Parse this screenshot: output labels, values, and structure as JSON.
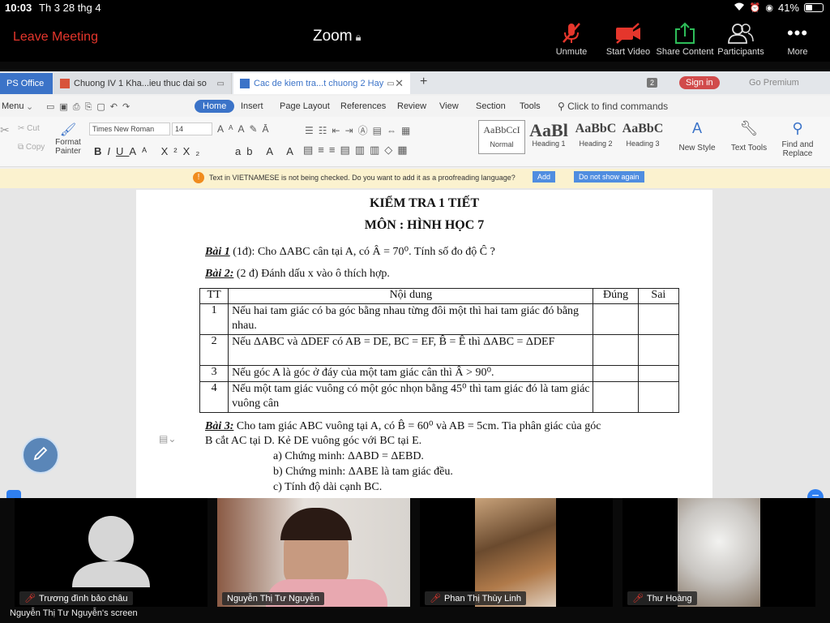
{
  "status_bar": {
    "time": "10:03",
    "date": "Th 3 28 thg 4",
    "battery": "41%",
    "battery_level": 0.41
  },
  "zoom": {
    "leave_label": "Leave Meeting",
    "title": "Zoom",
    "buttons": [
      {
        "label": "Unmute",
        "icon": "mic-muted-icon"
      },
      {
        "label": "Start Video",
        "icon": "video-off-icon"
      },
      {
        "label": "Share Content",
        "icon": "share-icon"
      },
      {
        "label": "Participants",
        "icon": "participants-icon"
      },
      {
        "label": "More",
        "icon": "more-icon"
      }
    ],
    "colors": {
      "leave": "#e5362c",
      "mute": "#e5362c",
      "share": "#2ebd59"
    }
  },
  "wps": {
    "tabs": {
      "office": "PS Office",
      "doc1": "Chuong IV 1 Kha...ieu thuc dai so",
      "doc2": "Cac de kiem tra...t chuong 2  Hay"
    },
    "tab_count": "2",
    "sign_in": "Sign in",
    "go_premium": "Go Premium",
    "menu": {
      "menu": "Menu",
      "home": "Home",
      "insert": "Insert",
      "page_layout": "Page Layout",
      "references": "References",
      "review": "Review",
      "view": "View",
      "section": "Section",
      "tools": "Tools",
      "find": "Click to find commands"
    },
    "ribbon": {
      "cut": "Cut",
      "copy": "Copy",
      "format_painter_1": "Format",
      "format_painter_2": "Painter",
      "font": "Times New Roman",
      "size": "14",
      "styles": [
        {
          "sample": "AaBbCcI",
          "name": "Normal"
        },
        {
          "sample": "AaBl",
          "name": "Heading 1"
        },
        {
          "sample": "AaBbC",
          "name": "Heading 2"
        },
        {
          "sample": "AaBbC",
          "name": "Heading 3"
        }
      ],
      "new_style": "New Style",
      "text_tools": "Text Tools",
      "find_replace_1": "Find and",
      "find_replace_2": "Replace"
    },
    "notice": {
      "message": "Text in VIETNAMESE is not being checked. Do you want to add it as a proofreading language?",
      "add": "Add",
      "dismiss": "Do not show again"
    }
  },
  "document": {
    "title": "KIỂM TRA 1 TIẾT",
    "subtitle": "MÔN : HÌNH HỌC 7",
    "bai1_label": "Bài 1",
    "bai1_text": "(1đ): Cho  ΔABC cân tại A, có  Â  = 70⁰. Tính   số đo độ  Ĉ ?",
    "bai2_label": "Bài 2:",
    "bai2_text": "(2 đ) Đánh dấu x vào ô thích hợp.",
    "table": {
      "headers": [
        "TT",
        "Nội dung",
        "Đúng",
        "Sai"
      ],
      "rows": [
        {
          "tt": "1",
          "content": "Nếu hai tam giác có ba góc bằng nhau từng đôi một thì hai tam giác đó bằng nhau."
        },
        {
          "tt": "2",
          "content": "Nếu  ΔABC và  ΔDEF có AB = DE, BC =  EF,  B̂ = Ê  thì  ΔABC =  ΔDEF"
        },
        {
          "tt": "3",
          "content": "Nếu góc A là góc ở đáy của một tam giác cân thì  Â  > 90⁰."
        },
        {
          "tt": "4",
          "content": "Nếu một tam giác vuông có một góc nhọn bằng 45⁰ thì tam giác đó là tam giác vuông cân"
        }
      ]
    },
    "bai3_label": "Bài 3:",
    "bai3_line1": "Cho tam giác ABC vuông tại A, có  B̂ = 60⁰ và AB = 5cm. Tia phân giác của góc",
    "bai3_line2": "B cắt AC tại D. Kẻ DE vuông góc với BC tại E.",
    "bai3_a": "a) Chứng minh:  ΔABD =  ΔEBD.",
    "bai3_b": "b) Chứng minh:  ΔABE là tam giác đều.",
    "bai3_c": "c) Tính độ dài cạnh BC."
  },
  "participants": [
    {
      "name": "Trương đình bảo châu",
      "muted": true
    },
    {
      "name": "Nguyễn Thị Tư Nguyễn",
      "muted": false
    },
    {
      "name": "Phan Thị Thùy Linh",
      "muted": true
    },
    {
      "name": "Thư Hoàng",
      "muted": true
    }
  ],
  "screen_label": "Nguyễn Thị Tư Nguyễn's screen"
}
